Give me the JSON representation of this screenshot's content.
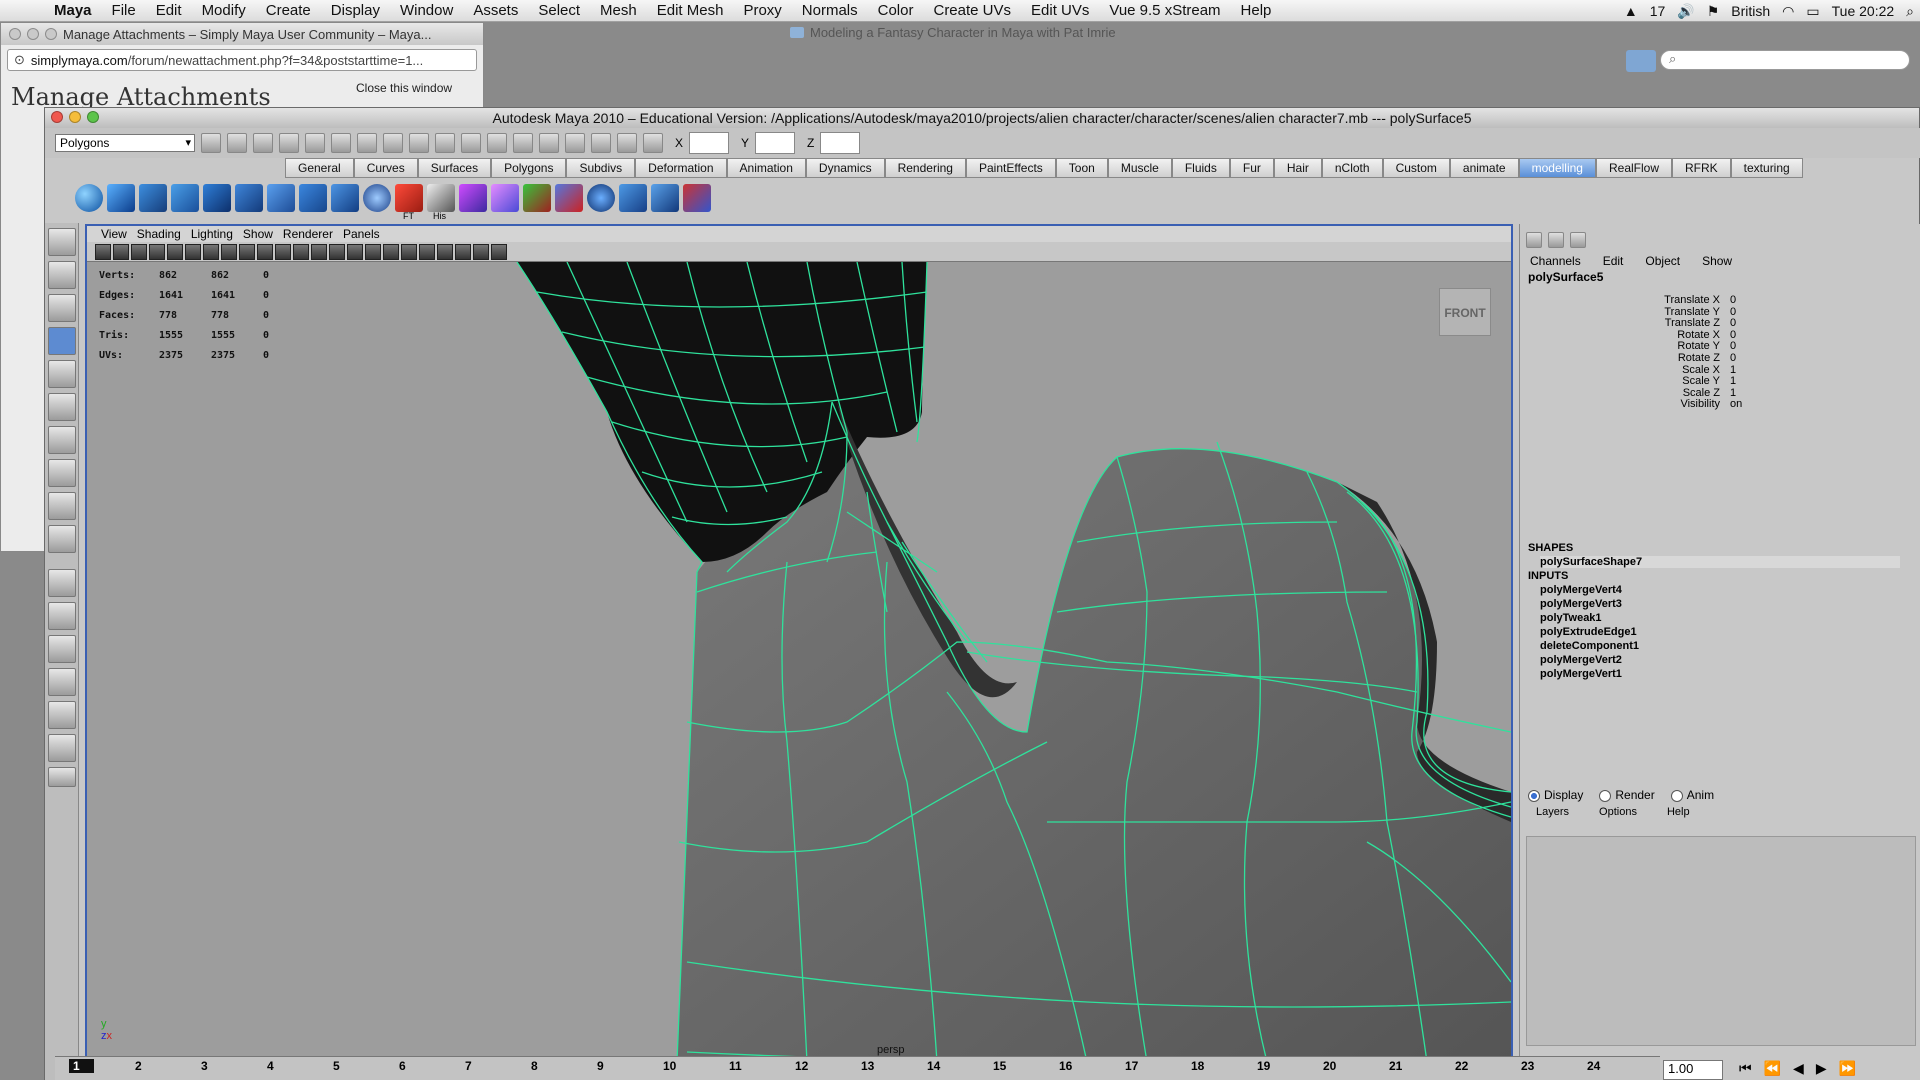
{
  "menubar": {
    "app": "Maya",
    "items": [
      "File",
      "Edit",
      "Modify",
      "Create",
      "Display",
      "Window",
      "Assets",
      "Select",
      "Mesh",
      "Edit Mesh",
      "Proxy",
      "Normals",
      "Color",
      "Create UVs",
      "Edit UVs",
      "Vue 9.5 xStream",
      "Help"
    ],
    "status": {
      "adobe": "17",
      "language": "British",
      "clock": "Tue 20:22"
    }
  },
  "browser": {
    "window_title": "Manage Attachments – Simply Maya User Community – Maya...",
    "address_domain": "simplymaya.com",
    "address_path": "/forum/newattachment.php?f=34&poststarttime=1...",
    "heading": "Manage Attachments",
    "close_link": "Close this window"
  },
  "background_window_title": "Modeling a Fantasy Character in Maya with Pat Imrie",
  "maya": {
    "title": "Autodesk Maya 2010 – Educational Version: /Applications/Autodesk/maya2010/projects/alien character/character/scenes/alien character7.mb   ---   polySurface5",
    "menu_set": "Polygons",
    "xyz_labels": [
      "X",
      "Y",
      "Z"
    ],
    "shelf_tabs": [
      "General",
      "Curves",
      "Surfaces",
      "Polygons",
      "Subdivs",
      "Deformation",
      "Animation",
      "Dynamics",
      "Rendering",
      "PaintEffects",
      "Toon",
      "Muscle",
      "Fluids",
      "Fur",
      "Hair",
      "nCloth",
      "Custom",
      "animate",
      "modelling",
      "RealFlow",
      "RFRK",
      "texturing"
    ],
    "active_shelf_tab": "modelling",
    "shelf_labels": {
      "ft": "FT",
      "his": "His"
    },
    "panel_menu": [
      "View",
      "Shading",
      "Lighting",
      "Show",
      "Renderer",
      "Panels"
    ],
    "hud": [
      {
        "label": "Verts:",
        "a": "862",
        "b": "862",
        "c": "0"
      },
      {
        "label": "Edges:",
        "a": "1641",
        "b": "1641",
        "c": "0"
      },
      {
        "label": "Faces:",
        "a": "778",
        "b": "778",
        "c": "0"
      },
      {
        "label": "Tris:",
        "a": "1555",
        "b": "1555",
        "c": "0"
      },
      {
        "label": "UVs:",
        "a": "2375",
        "b": "2375",
        "c": "0"
      }
    ],
    "viewcube": "FRONT",
    "camera": "persp",
    "channel_box": {
      "menu": [
        "Channels",
        "Edit",
        "Object",
        "Show"
      ],
      "object": "polySurface5",
      "attributes": [
        {
          "name": "Translate X",
          "value": "0"
        },
        {
          "name": "Translate Y",
          "value": "0"
        },
        {
          "name": "Translate Z",
          "value": "0"
        },
        {
          "name": "Rotate X",
          "value": "0"
        },
        {
          "name": "Rotate Y",
          "value": "0"
        },
        {
          "name": "Rotate Z",
          "value": "0"
        },
        {
          "name": "Scale X",
          "value": "1"
        },
        {
          "name": "Scale Y",
          "value": "1"
        },
        {
          "name": "Scale Z",
          "value": "1"
        },
        {
          "name": "Visibility",
          "value": "on"
        }
      ],
      "shapes_label": "SHAPES",
      "shape": "polySurfaceShape7",
      "inputs_label": "INPUTS",
      "inputs": [
        "polyMergeVert4",
        "polyMergeVert3",
        "polyTweak1",
        "polyExtrudeEdge1",
        "deleteComponent1",
        "polyMergeVert2",
        "polyMergeVert1"
      ]
    },
    "layer_editor": {
      "modes": [
        "Display",
        "Render",
        "Anim"
      ],
      "menu": [
        "Layers",
        "Options",
        "Help"
      ],
      "scroll": "<<"
    },
    "time_ticks": [
      "1",
      "2",
      "3",
      "4",
      "5",
      "6",
      "7",
      "8",
      "9",
      "10",
      "11",
      "12",
      "13",
      "14",
      "15",
      "16",
      "17",
      "18",
      "19",
      "20",
      "21",
      "22",
      "23",
      "24"
    ],
    "current_frame": "1.00"
  },
  "colors": {
    "wire": "#2fe29c",
    "selection_border": "#3a5fb3",
    "active_tab": "#5a8fd8"
  }
}
